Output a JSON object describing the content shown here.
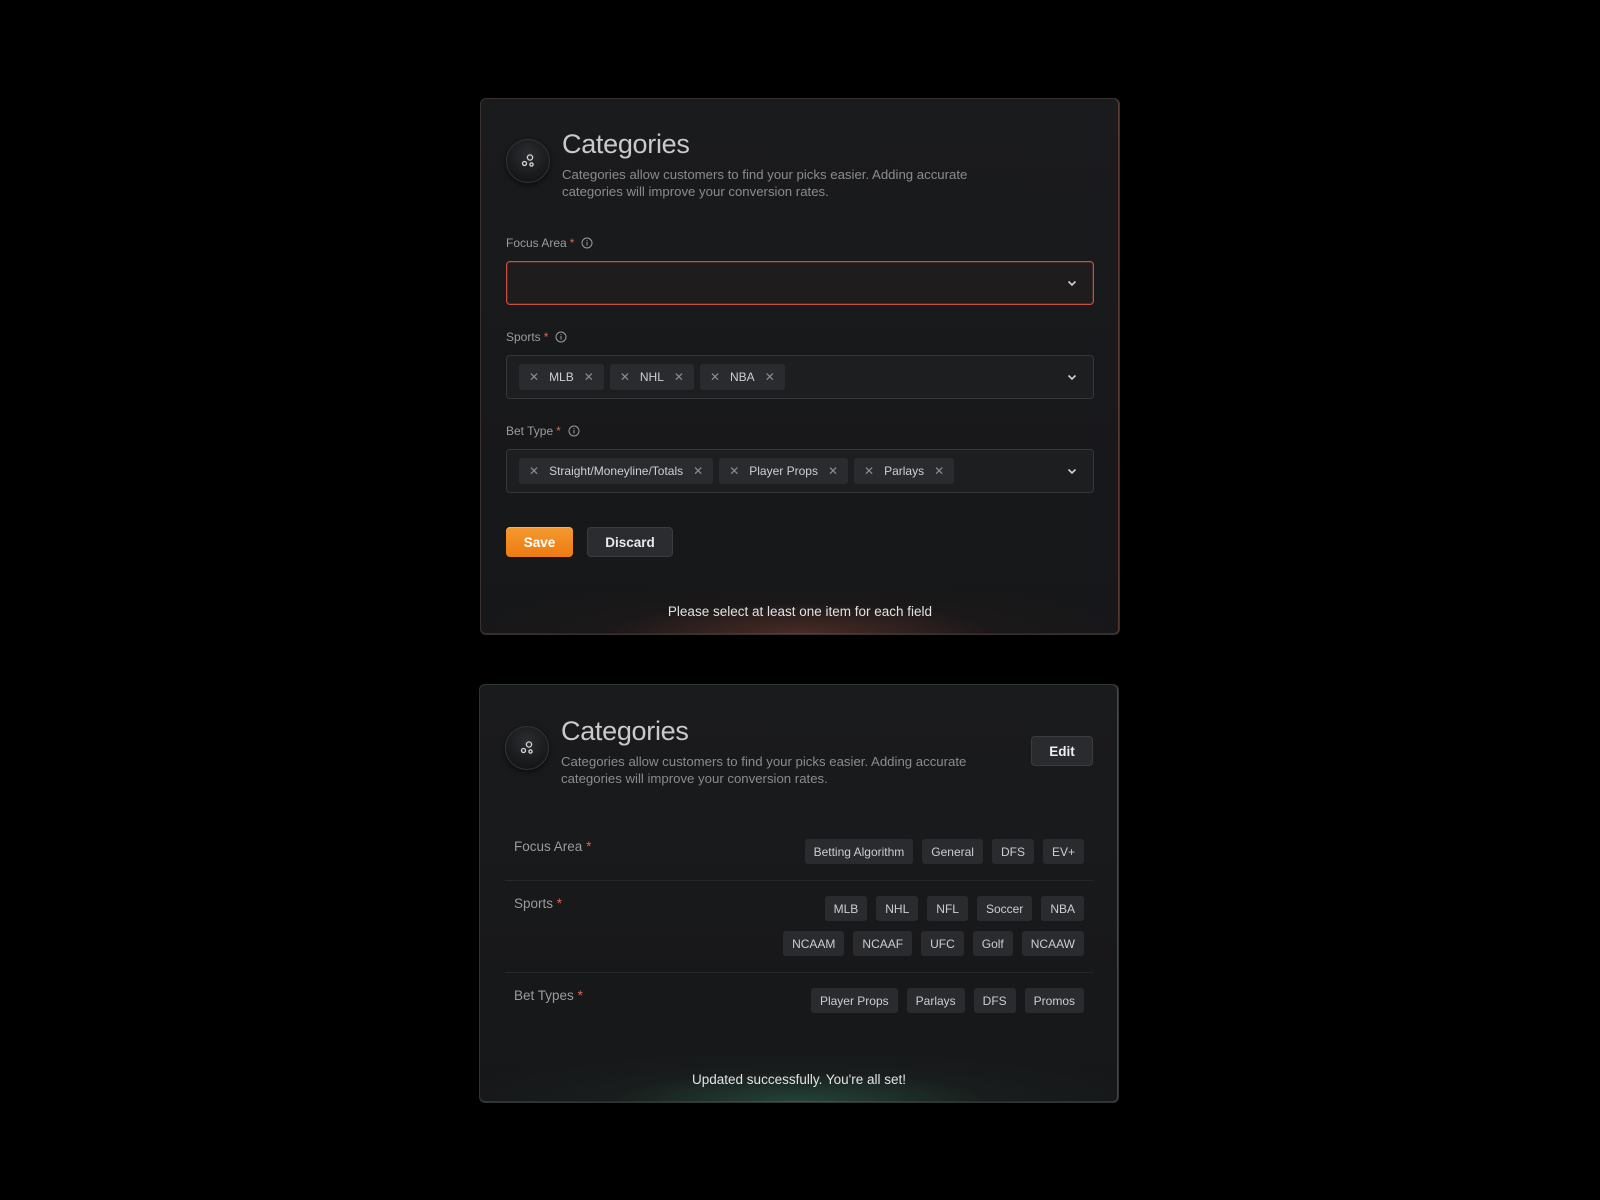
{
  "edit_card": {
    "title": "Categories",
    "description": "Categories allow customers to find your picks easier. Adding accurate categories will improve your conversion rates.",
    "focus_area": {
      "label": "Focus Area",
      "required_mark": "*",
      "value": ""
    },
    "sports": {
      "label": "Sports",
      "required_mark": "*",
      "chips": [
        "MLB",
        "NHL",
        "NBA"
      ]
    },
    "bet_type": {
      "label": "Bet Type",
      "required_mark": "*",
      "chips": [
        "Straight/Moneyline/Totals",
        "Player Props",
        "Parlays"
      ]
    },
    "save_label": "Save",
    "discard_label": "Discard",
    "error_message": "Please select at least one item for each field"
  },
  "view_card": {
    "title": "Categories",
    "description": "Categories allow customers to find your picks easier. Adding accurate categories will improve your conversion rates.",
    "edit_label": "Edit",
    "focus_area": {
      "label": "Focus Area",
      "required_mark": "*",
      "tags": [
        "Betting Algorithm",
        "General",
        "DFS",
        "EV+"
      ]
    },
    "sports": {
      "label": "Sports",
      "required_mark": "*",
      "tags_row1": [
        "MLB",
        "NHL",
        "NFL",
        "Soccer",
        "NBA"
      ],
      "tags_row2": [
        "NCAAM",
        "NCAAF",
        "UFC",
        "Golf",
        "NCAAW"
      ]
    },
    "bet_types": {
      "label": "Bet Types",
      "required_mark": "*",
      "tags": [
        "Player Props",
        "Parlays",
        "DFS",
        "Promos"
      ]
    },
    "success_message": "Updated successfully. You're all set!"
  },
  "colors": {
    "accent": "#ee7a13",
    "error": "#c9513d",
    "success": "#3c966e",
    "required": "#e0664a"
  },
  "icons": [
    "nodes-icon",
    "info-icon",
    "chevron-down-icon",
    "close-icon"
  ]
}
